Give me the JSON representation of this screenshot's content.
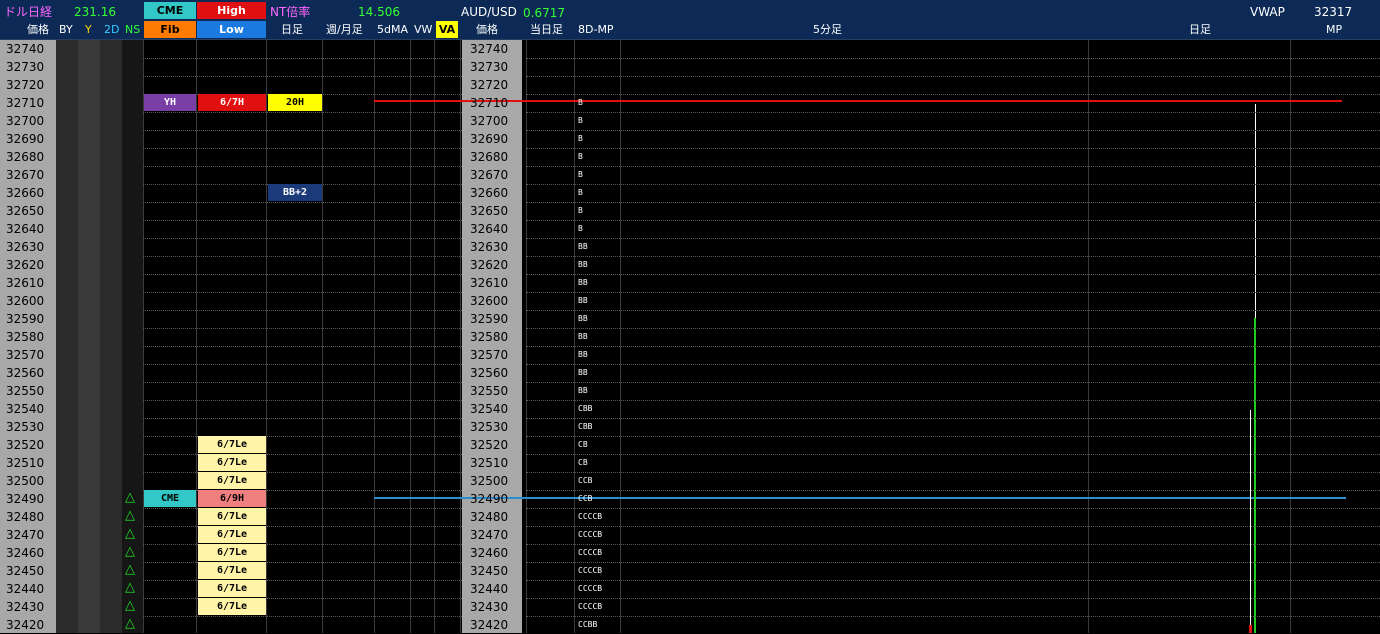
{
  "header": {
    "dollar_nikkei_label": "ドル日経",
    "dollar_nikkei_value": "231.16",
    "nt_ratio_label": "NT倍率",
    "nt_ratio_value": "14.506",
    "audusd_label": "AUD/USD",
    "audusd_value": "0.6717",
    "vwap_label": "VWAP",
    "vwap_value": "32317",
    "badge_cme": "CME",
    "badge_high": "High",
    "badge_fib": "Fib",
    "badge_low": "Low",
    "cols": {
      "price": "価格",
      "by": "BY",
      "y": "Y",
      "d2": "2D",
      "ns": "NS",
      "daily": "日足",
      "weekly_monthly": "週/月足",
      "ma5": "5dMA",
      "vw": "VW",
      "va": "VA",
      "price2": "価格",
      "today": "当日足",
      "mp8d": "8D-MP",
      "min5": "5分足",
      "daily2": "日足",
      "mp": "MP"
    }
  },
  "prices": [
    "32740",
    "32730",
    "32720",
    "32710",
    "32700",
    "32690",
    "32680",
    "32670",
    "32660",
    "32650",
    "32640",
    "32630",
    "32620",
    "32610",
    "32600",
    "32590",
    "32580",
    "32570",
    "32560",
    "32550",
    "32540",
    "32530",
    "32520",
    "32510",
    "32500",
    "32490",
    "32480",
    "32470",
    "32460",
    "32450",
    "32440",
    "32430",
    "32420"
  ],
  "tags": [
    {
      "row": 3,
      "col": "fib",
      "text": "YH",
      "bg": "#7a3fa6",
      "fg": "#ffffff"
    },
    {
      "row": 3,
      "col": "low",
      "text": "6/7H",
      "bg": "#e01010",
      "fg": "#ffffff"
    },
    {
      "row": 3,
      "col": "daily",
      "text": "20H",
      "bg": "#ffff00",
      "fg": "#000000"
    },
    {
      "row": 8,
      "col": "daily",
      "text": "BB+2",
      "bg": "#1a3a7a",
      "fg": "#ffffff"
    },
    {
      "row": 22,
      "col": "low",
      "text": "6/7Le",
      "bg": "#fff4a8",
      "fg": "#000000"
    },
    {
      "row": 23,
      "col": "low",
      "text": "6/7Le",
      "bg": "#fff4a8",
      "fg": "#000000"
    },
    {
      "row": 24,
      "col": "low",
      "text": "6/7Le",
      "bg": "#fff4a8",
      "fg": "#000000"
    },
    {
      "row": 25,
      "col": "fib",
      "text": "CME",
      "bg": "#33c8c8",
      "fg": "#000000"
    },
    {
      "row": 25,
      "col": "low",
      "text": "6/9H",
      "bg": "#f08080",
      "fg": "#000000"
    },
    {
      "row": 26,
      "col": "low",
      "text": "6/7Le",
      "bg": "#fff4a8",
      "fg": "#000000"
    },
    {
      "row": 27,
      "col": "low",
      "text": "6/7Le",
      "bg": "#fff4a8",
      "fg": "#000000"
    },
    {
      "row": 28,
      "col": "low",
      "text": "6/7Le",
      "bg": "#fff4a8",
      "fg": "#000000"
    },
    {
      "row": 29,
      "col": "low",
      "text": "6/7Le",
      "bg": "#fff4a8",
      "fg": "#000000"
    },
    {
      "row": 30,
      "col": "low",
      "text": "6/7Le",
      "bg": "#fff4a8",
      "fg": "#000000"
    },
    {
      "row": 31,
      "col": "low",
      "text": "6/7Le",
      "bg": "#fff4a8",
      "fg": "#000000"
    }
  ],
  "ns_markers": [
    25,
    26,
    27,
    28,
    29,
    30,
    31,
    32
  ],
  "tpo": [
    "",
    "",
    "",
    "B",
    "B",
    "B",
    "B",
    "B",
    "B",
    "B",
    "B",
    "BB",
    "BB",
    "BB",
    "BB",
    "BB",
    "BB",
    "BB",
    "BB",
    "BB",
    "CBB",
    "CBB",
    "CB",
    "CB",
    "CCB",
    "CCB",
    "CCCCB",
    "CCCCB",
    "CCCCB",
    "CCCCB",
    "CCCCB",
    "CCCCB",
    "CCBB"
  ],
  "colors": {
    "red_line": "#e01010",
    "blue_line": "#2a8fd0",
    "green_bar": "#22cc22",
    "price_bg": "#a8a8a8"
  }
}
